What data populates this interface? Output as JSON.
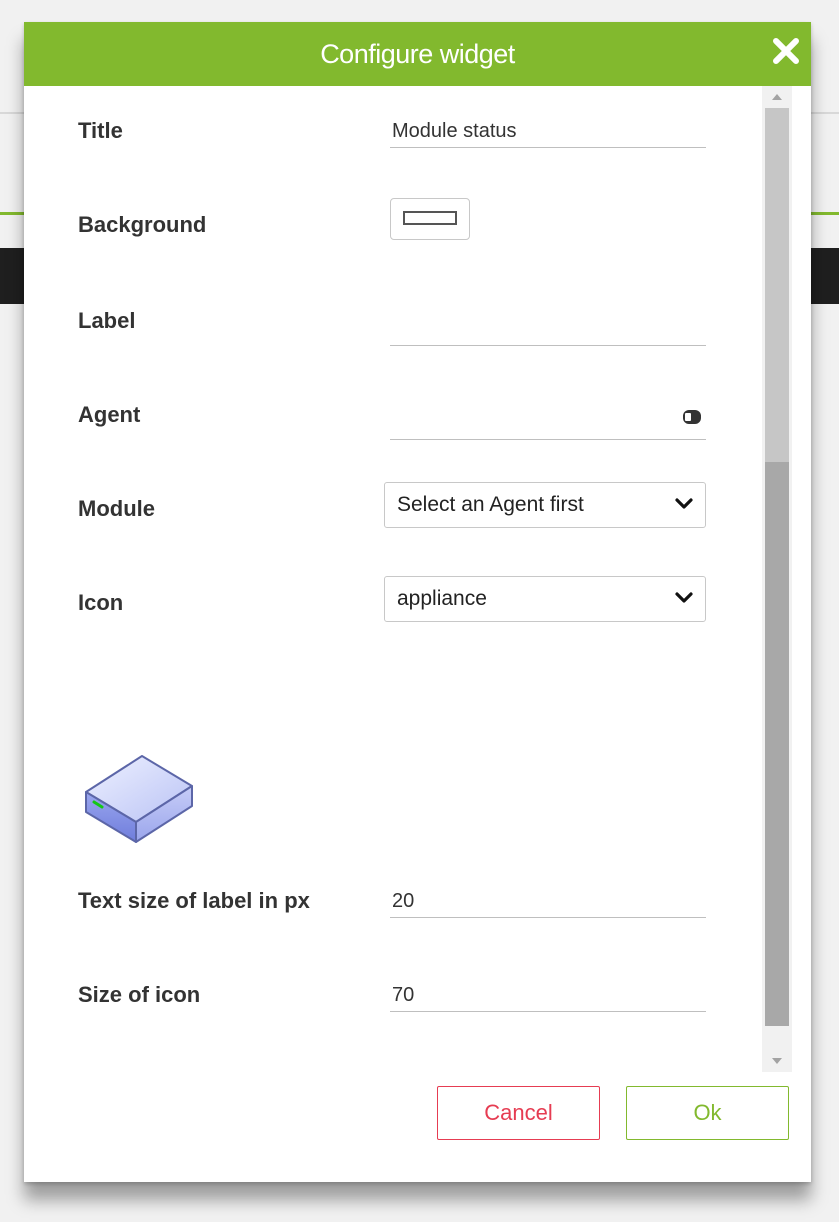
{
  "dialog": {
    "title": "Configure widget",
    "accent_color": "#82b92e",
    "close_icon": "close-icon"
  },
  "form": {
    "title": {
      "label": "Title",
      "value": "Module status"
    },
    "background": {
      "label": "Background",
      "value": "#ffffff"
    },
    "label": {
      "label": "Label",
      "value": ""
    },
    "agent": {
      "label": "Agent",
      "value": "",
      "icon": "agent-icon"
    },
    "module": {
      "label": "Module",
      "value": "Select an Agent first"
    },
    "icon": {
      "label": "Icon",
      "value": "appliance",
      "preview_icon": "appliance-icon"
    },
    "text_size": {
      "label": "Text size of label in px",
      "value": "20"
    },
    "icon_size": {
      "label": "Size of icon",
      "value": "70"
    }
  },
  "footer": {
    "cancel_label": "Cancel",
    "ok_label": "Ok",
    "cancel_color": "#e63c52",
    "ok_color": "#82b92e"
  }
}
